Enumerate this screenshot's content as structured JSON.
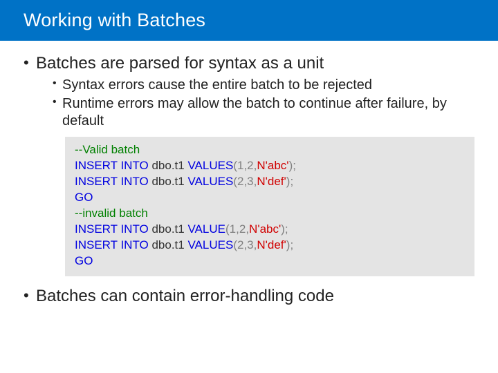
{
  "colors": {
    "accent": "#0072c6",
    "code_bg": "#e4e4e4",
    "comment": "#008000",
    "keyword": "#0000e0",
    "string": "#d00000",
    "number_punct": "#808080"
  },
  "title": "Working with Batches",
  "bullets": {
    "b1": "Batches are parsed for syntax as a unit",
    "b1_sub1": "Syntax errors cause the entire batch to be rejected",
    "b1_sub2": "Runtime errors may allow the batch to continue after failure, by default",
    "b2": "Batches can contain error-handling code"
  },
  "code": {
    "c1_comment": "--Valid batch",
    "c2_kw1": "INSERT INTO",
    "c2_obj": " dbo.t1 ",
    "c2_kw2": "VALUES",
    "c2_paren_open": "(",
    "c2_n1": "1",
    "c2_c1": ",",
    "c2_n2": "2",
    "c2_c2": ",",
    "c2_str": "N'abc'",
    "c2_paren_close": ");",
    "c3_kw1": "INSERT INTO",
    "c3_obj": " dbo.t1 ",
    "c3_kw2": "VALUES",
    "c3_paren_open": "(",
    "c3_n1": "2",
    "c3_c1": ",",
    "c3_n2": "3",
    "c3_c2": ",",
    "c3_str": "N'def'",
    "c3_paren_close": ");",
    "c4_go": "GO",
    "c5_comment": "--invalid batch",
    "c6_kw1": "INSERT INTO",
    "c6_obj": " dbo.t1 ",
    "c6_kw2": "VALUE",
    "c6_paren_open": "(",
    "c6_n1": "1",
    "c6_c1": ",",
    "c6_n2": "2",
    "c6_c2": ",",
    "c6_str": "N'abc'",
    "c6_paren_close": ");",
    "c7_kw1": "INSERT INTO",
    "c7_obj": " dbo.t1 ",
    "c7_kw2": "VALUES",
    "c7_paren_open": "(",
    "c7_n1": "2",
    "c7_c1": ",",
    "c7_n2": "3",
    "c7_c2": ",",
    "c7_str": "N'def'",
    "c7_paren_close": ");",
    "c8_go": "GO"
  }
}
